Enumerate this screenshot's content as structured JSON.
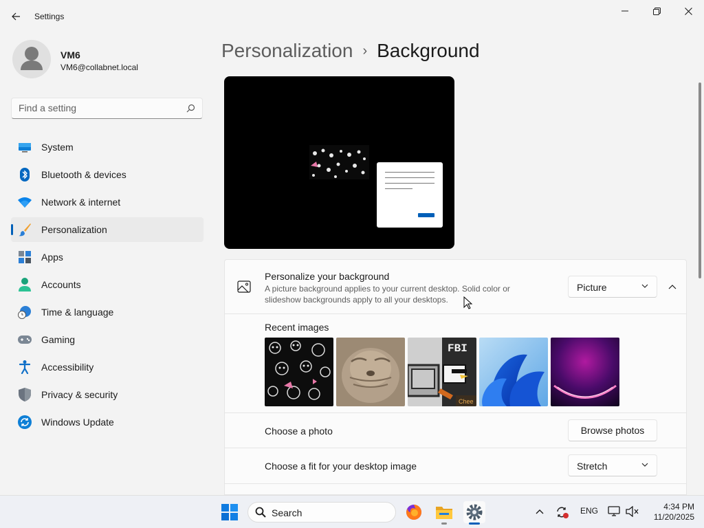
{
  "window": {
    "title": "Settings"
  },
  "profile": {
    "name": "VM6",
    "email": "VM6@collabnet.local"
  },
  "search": {
    "placeholder": "Find a setting"
  },
  "sidebar": {
    "items": [
      {
        "label": "System",
        "icon": "system-icon"
      },
      {
        "label": "Bluetooth & devices",
        "icon": "bluetooth-icon"
      },
      {
        "label": "Network & internet",
        "icon": "wifi-icon"
      },
      {
        "label": "Personalization",
        "icon": "brush-icon",
        "active": true
      },
      {
        "label": "Apps",
        "icon": "apps-icon"
      },
      {
        "label": "Accounts",
        "icon": "accounts-icon"
      },
      {
        "label": "Time & language",
        "icon": "clock-globe-icon"
      },
      {
        "label": "Gaming",
        "icon": "gamepad-icon"
      },
      {
        "label": "Accessibility",
        "icon": "accessibility-icon"
      },
      {
        "label": "Privacy & security",
        "icon": "shield-icon"
      },
      {
        "label": "Windows Update",
        "icon": "update-icon"
      }
    ]
  },
  "header": {
    "parent": "Personalization",
    "separator": "›",
    "current": "Background"
  },
  "background": {
    "title": "Personalize your background",
    "description_line1": "A picture background applies to your current desktop. Solid color or",
    "description_line2": "slideshow backgrounds apply to all your desktops.",
    "type_value": "Picture",
    "recent_images_label": "Recent images",
    "recent_images": [
      "cats-collage",
      "seal-photo",
      "fbi-pixel-art",
      "windows-bloom",
      "purple-glow"
    ],
    "choose_photo_label": "Choose a photo",
    "browse_label": "Browse photos",
    "fit_label": "Choose a fit for your desktop image",
    "fit_value": "Stretch"
  },
  "taskbar": {
    "search_label": "Search",
    "language": "ENG",
    "time": "4:34 PM",
    "date": "11/20/2025"
  },
  "colors": {
    "accent": "#005fb8",
    "window_bg": "#f3f3f3",
    "card_bg": "#fbfbfb"
  }
}
